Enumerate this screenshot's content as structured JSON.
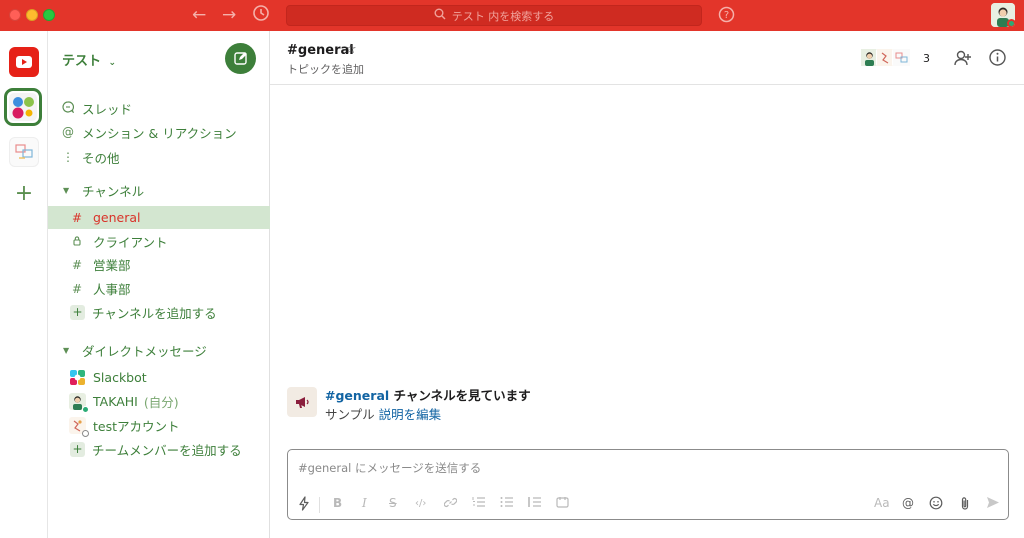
{
  "titlebar": {
    "search_placeholder": "テスト 内を検索する",
    "colors": {
      "bar": "#e3352a"
    }
  },
  "workspace": {
    "name": "テスト",
    "dropdown_icon": "chevron-down-icon"
  },
  "nav": [
    {
      "label": "スレッド",
      "icon": "threads-icon"
    },
    {
      "label": "メンション & リアクション",
      "icon": "at-icon"
    },
    {
      "label": "その他",
      "icon": "more-vertical-icon"
    }
  ],
  "channels_section": {
    "title": "チャンネル"
  },
  "channels": [
    {
      "name": "general",
      "icon": "#",
      "active": true
    },
    {
      "name": "クライアント",
      "icon": "lock",
      "active": false
    },
    {
      "name": "営業部",
      "icon": "#",
      "active": false
    },
    {
      "name": "人事部",
      "icon": "#",
      "active": false
    }
  ],
  "add_channel": "チャンネルを追加する",
  "dm_section": {
    "title": "ダイレクトメッセージ"
  },
  "dms": [
    {
      "name": "Slackbot"
    },
    {
      "name": "TAKAHI",
      "suffix": "(自分)"
    },
    {
      "name": "testアカウント"
    }
  ],
  "add_member": "チームメンバーを追加する",
  "channel_header": {
    "title": "#general",
    "topic": "トピックを追加",
    "member_count": "3"
  },
  "intro": {
    "channel_link": "#general",
    "title_rest": " チャンネルを見ています",
    "sub_text": "サンプル ",
    "edit_link": "説明を編集"
  },
  "composer": {
    "placeholder": "#general にメッセージを送信する",
    "font_toggle": "Aa"
  }
}
